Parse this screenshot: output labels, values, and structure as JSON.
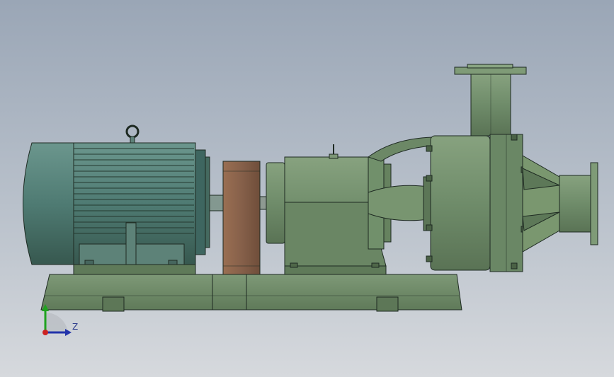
{
  "viewport": {
    "background_top": "#9aa6b6",
    "background_bottom": "#d6d9dd"
  },
  "model": {
    "motor_color": "#4f7b73",
    "motor_fin_color": "#3e6660",
    "pump_color": "#6f8c6a",
    "base_color": "#6e8a66",
    "coupling_guard_color": "#8a6148",
    "edge_color": "#1e2a22"
  },
  "triad": {
    "z_label": "Z",
    "y_color": "#1fa31f",
    "z_color": "#2233aa",
    "origin_color": "#cc2222",
    "icon": "coordinate-triad-icon"
  }
}
